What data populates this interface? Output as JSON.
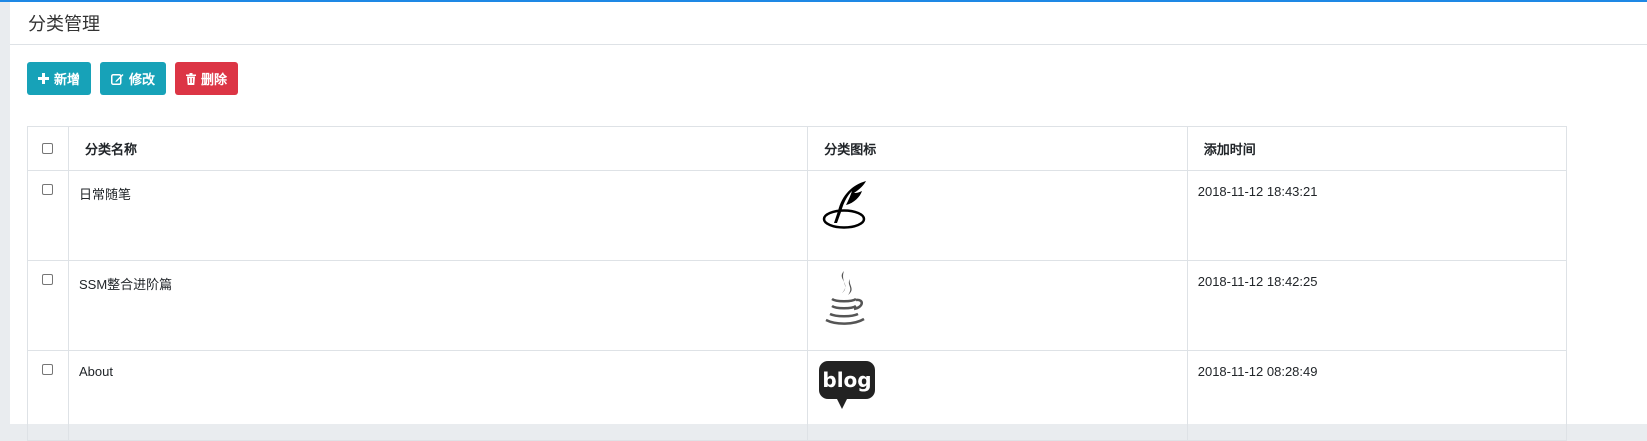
{
  "page": {
    "title": "分类管理"
  },
  "toolbar": {
    "add_label": "新增",
    "edit_label": "修改",
    "delete_label": "删除"
  },
  "table": {
    "headers": {
      "name": "分类名称",
      "icon": "分类图标",
      "time": "添加时间"
    },
    "rows": [
      {
        "name": "日常随笔",
        "icon": "feather-pen-icon",
        "time": "2018-11-12 18:43:21"
      },
      {
        "name": "SSM整合进阶篇",
        "icon": "java-coffee-icon",
        "time": "2018-11-12 18:42:25"
      },
      {
        "name": "About",
        "icon": "blog-bubble-icon",
        "time": "2018-11-12 08:28:49"
      }
    ]
  },
  "colors": {
    "accent": "#1e88e5",
    "info": "#17a2b8",
    "danger": "#dc3545",
    "border": "#dee2e6"
  }
}
